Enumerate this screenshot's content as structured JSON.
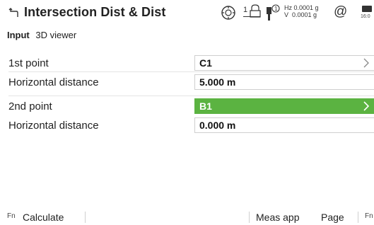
{
  "header": {
    "title": "Intersection Dist & Dist",
    "face_indicator": "1",
    "prism_indicator": "1",
    "accuracy_hz": "Hz 0.0001 g",
    "accuracy_v": "V  0.0001 g",
    "at_symbol": "@",
    "battery_text": "16:0"
  },
  "tabs": [
    {
      "label": "Input",
      "active": true
    },
    {
      "label": "3D viewer",
      "active": false
    }
  ],
  "form": {
    "rows": [
      {
        "label": "1st point",
        "value": "C1",
        "has_chevron": true,
        "selected": false
      },
      {
        "label": "Horizontal distance",
        "value": "5.000 m",
        "has_chevron": false,
        "selected": false
      },
      {
        "label": "2nd point",
        "value": "B1",
        "has_chevron": true,
        "selected": true
      },
      {
        "label": "Horizontal distance",
        "value": "0.000 m",
        "has_chevron": false,
        "selected": false
      }
    ]
  },
  "bottom_bar": {
    "fn_left": "Fn",
    "calculate": "Calculate",
    "meas_app": "Meas app",
    "page": "Page",
    "fn_right": "Fn"
  },
  "colors": {
    "selected_field": "#5bb341",
    "text": "#222222",
    "border": "#cfcfcf"
  }
}
